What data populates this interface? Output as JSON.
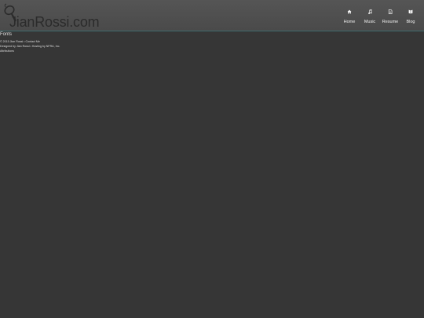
{
  "site": {
    "logo_text": "JianRossi.com"
  },
  "nav": {
    "items": [
      {
        "label": "Home",
        "icon": "home-icon"
      },
      {
        "label": "Music",
        "icon": "music-note-icon"
      },
      {
        "label": "Resume",
        "icon": "document-icon"
      },
      {
        "label": "Blog",
        "icon": "book-icon"
      }
    ]
  },
  "main": {
    "title": "Fonts"
  },
  "footer": {
    "line1": "© 2015 Jian Rossi • Contact Me",
    "line2": "Designed by Jian Rossi • Hosting by NFRA, Inc.",
    "line3": "Attributions"
  },
  "colors": {
    "background": "#363636",
    "header": "#4f4f4f",
    "header_border": "#3f6a6e",
    "logo_text": "#2b2b2b"
  }
}
